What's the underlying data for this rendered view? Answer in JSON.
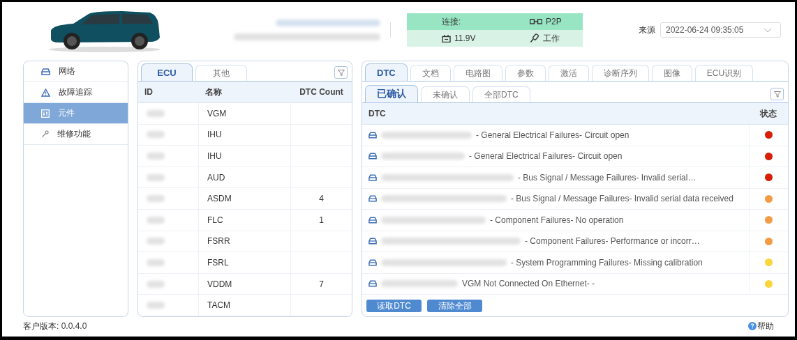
{
  "status": {
    "connection_label": "连接:",
    "connection_value": "P2P",
    "voltage": "11.9V",
    "ignition": "工作"
  },
  "source": {
    "label": "来源",
    "value": "2022-06-24 09:35:05"
  },
  "sidebar": {
    "items": [
      {
        "label": "网络",
        "selected": false
      },
      {
        "label": "故障追踪",
        "selected": false
      },
      {
        "label": "元件",
        "selected": true
      },
      {
        "label": "维修功能",
        "selected": false
      }
    ]
  },
  "ecu_panel": {
    "tabs": [
      {
        "label": "ECU",
        "selected": true
      },
      {
        "label": "其他",
        "selected": false
      }
    ],
    "columns": [
      "ID",
      "名称",
      "DTC Count"
    ],
    "rows": [
      {
        "name": "VGM",
        "dtc_count": ""
      },
      {
        "name": "IHU",
        "dtc_count": ""
      },
      {
        "name": "IHU",
        "dtc_count": ""
      },
      {
        "name": "AUD",
        "dtc_count": ""
      },
      {
        "name": "ASDM",
        "dtc_count": "4"
      },
      {
        "name": "FLC",
        "dtc_count": "1"
      },
      {
        "name": "FSRR",
        "dtc_count": ""
      },
      {
        "name": "FSRL",
        "dtc_count": ""
      },
      {
        "name": "VDDM",
        "dtc_count": "7"
      },
      {
        "name": "TACM",
        "dtc_count": ""
      }
    ]
  },
  "dtc_panel": {
    "tabs": [
      {
        "label": "DTC",
        "selected": true
      },
      {
        "label": "文档",
        "selected": false
      },
      {
        "label": "电路图",
        "selected": false
      },
      {
        "label": "参数",
        "selected": false
      },
      {
        "label": "激活",
        "selected": false
      },
      {
        "label": "诊断序列",
        "selected": false
      },
      {
        "label": "图像",
        "selected": false
      },
      {
        "label": "ECU识别",
        "selected": false
      }
    ],
    "subtabs": [
      {
        "label": "已确认",
        "selected": true
      },
      {
        "label": "未确认",
        "selected": false
      },
      {
        "label": "全部DTC",
        "selected": false
      }
    ],
    "columns": [
      "DTC",
      "状态"
    ],
    "rows": [
      {
        "description": "- General Electrical Failures- Circuit open",
        "color": "#d81e06"
      },
      {
        "description": "- General Electrical Failures- Circuit open",
        "color": "#d81e06"
      },
      {
        "description": "- Bus Signal / Message Failures- Invalid serial…",
        "color": "#d81e06"
      },
      {
        "description": "- Bus Signal / Message Failures- Invalid serial data received",
        "color": "#f39c45"
      },
      {
        "description": "- Component Failures- No operation",
        "color": "#f39c45"
      },
      {
        "description": "- Component Failures- Performance or incorr…",
        "color": "#f39c45"
      },
      {
        "description": "- System Programming Failures- Missing calibration",
        "color": "#fad53c"
      },
      {
        "description": "VGM Not Connected On Ethernet- -",
        "color": "#fad53c"
      }
    ],
    "buttons": [
      "读取DTC",
      "清除全部"
    ]
  },
  "footer": {
    "version": "客户版本: 0.0.4.0",
    "help": "帮助"
  }
}
